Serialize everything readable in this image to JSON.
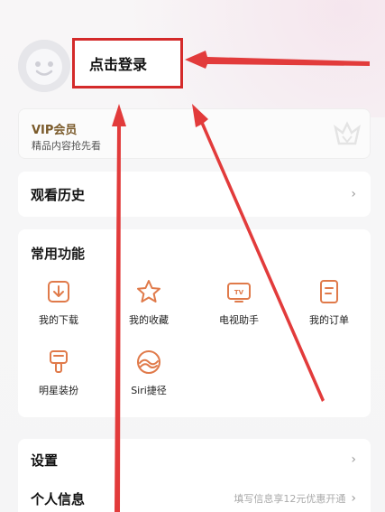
{
  "profile": {
    "login_label": "点击登录"
  },
  "vip": {
    "title": "VIP会员",
    "subtitle": "精品内容抢先看"
  },
  "history": {
    "label": "观看历史"
  },
  "features": {
    "title": "常用功能",
    "items": [
      {
        "label": "我的下载",
        "icon": "download-icon"
      },
      {
        "label": "我的收藏",
        "icon": "star-icon"
      },
      {
        "label": "电视助手",
        "icon": "tv-icon"
      },
      {
        "label": "我的订单",
        "icon": "order-icon"
      },
      {
        "label": "明星装扮",
        "icon": "brush-icon"
      },
      {
        "label": "Siri捷径",
        "icon": "siri-icon"
      }
    ]
  },
  "settings": {
    "label": "设置"
  },
  "personal": {
    "label": "个人信息",
    "hint": "填写信息享12元优惠开通"
  },
  "colors": {
    "accent": "#e07a4a",
    "annotation_red": "#d42a2a",
    "vip_gold": "#7a5a2a"
  }
}
